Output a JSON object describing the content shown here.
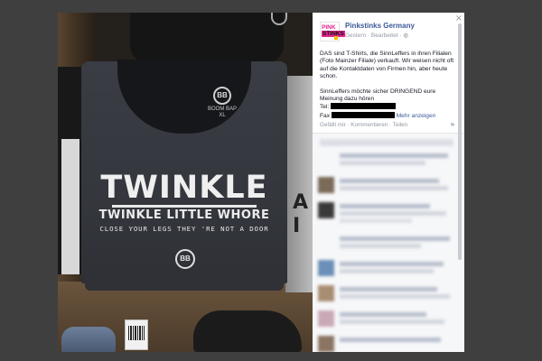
{
  "photo": {
    "shirt_tag_logo": "BB",
    "shirt_tag_text": "BOOM BAP\nXL",
    "print_main": "TWINKLE",
    "print_sub": "TWINKLE LITTLE WHORE",
    "print_line": "CLOSE YOUR LEGS THEY 'RE NOT A DOOR",
    "print_logo": "BB",
    "right_shirt_mark": "A\nI"
  },
  "panel": {
    "close_symbol": "×",
    "avatar": {
      "line1": "PINK",
      "line2": "STINKS"
    },
    "page_name": "Pinkstinks Germany",
    "meta": "Gestern · Bearbeitet ·",
    "post": {
      "paragraph1": "DAS sind T-Shirts, die SinnLeffers in ihren Filialen (Foto Mainzer Filiale) verkauft. Wir weisen nicht oft auf die Kontaktdaten von Firmen hin, aber heute schon.",
      "paragraph2_line1": "SinnLeffers möchte sicher DRINGEND eure Meinung dazu hören",
      "tel_label": "Tel:",
      "fax_label": "Fax",
      "more_link": "Mehr anzeigen"
    },
    "actions": "Gefällt mir · Kommentieren · Teilen",
    "flag_icon": "⚑"
  },
  "colors": {
    "facebook_blue": "#3b5998",
    "meta_grey": "#9197a3",
    "brand_pink": "#e2258c",
    "overlay_bg": "#3f3f3f"
  }
}
